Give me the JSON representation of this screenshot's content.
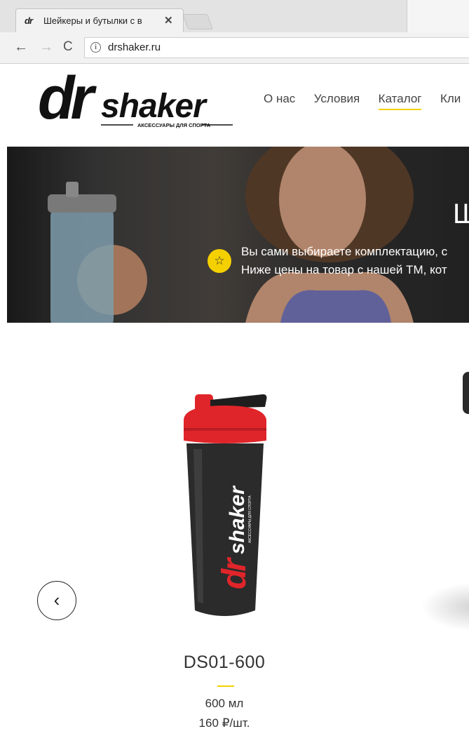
{
  "browser": {
    "tab": {
      "favicon_text": "dr",
      "title": "Шейкеры и бутылки с в",
      "close_glyph": "✕"
    },
    "nav": {
      "back_glyph": "←",
      "forward_glyph": "→",
      "reload_glyph": "C"
    },
    "address": {
      "info_glyph": "i",
      "url": "drshaker.ru"
    }
  },
  "header": {
    "logo": {
      "wordmark_dr": "dr",
      "wordmark_shaker": "shaker",
      "tagline": "АКСЕССУАРЫ ДЛЯ СПОРТА"
    },
    "nav_items": [
      {
        "label": "О нас",
        "active": false
      },
      {
        "label": "Условия",
        "active": false
      },
      {
        "label": "Каталог",
        "active": true
      },
      {
        "label": "Кли",
        "active": false
      }
    ]
  },
  "hero": {
    "heading": "Ш",
    "star_glyph": "☆",
    "line1": "Вы сами выбираете комплектацию, с",
    "line2": "Ниже цены на товар с нашей ТМ, кот"
  },
  "catalog": {
    "prev_glyph": "‹",
    "product": {
      "name": "DS01-600",
      "volume": "600 мл",
      "price": "160 ₽/шт.",
      "label_dr": "dr",
      "label_shaker": "shaker",
      "label_tagline": "АКСЕССУАРЫ ДЛЯ СПОРТА"
    }
  },
  "colors": {
    "accent_yellow": "#f5d000",
    "lid_red": "#e0252a",
    "bottle_body": "#2b2b2b"
  }
}
